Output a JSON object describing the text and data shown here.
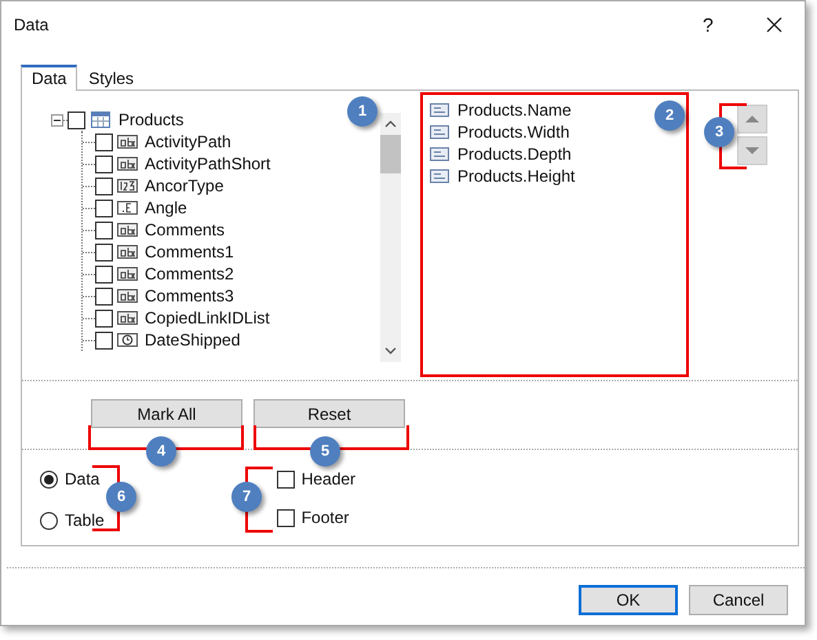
{
  "window": {
    "title": "Data",
    "help": "?"
  },
  "tabs": [
    {
      "label": "Data",
      "selected": true
    },
    {
      "label": "Styles",
      "selected": false
    }
  ],
  "tree": {
    "label": "Products",
    "expanded": true,
    "checked": false,
    "children": [
      {
        "label": "ActivityPath",
        "kind": "text",
        "checked": false
      },
      {
        "label": "ActivityPathShort",
        "kind": "text",
        "checked": false
      },
      {
        "label": "AncorType",
        "kind": "integer",
        "checked": false
      },
      {
        "label": "Angle",
        "kind": "float",
        "checked": false
      },
      {
        "label": "Comments",
        "kind": "text",
        "checked": false
      },
      {
        "label": "Comments1",
        "kind": "text",
        "checked": false
      },
      {
        "label": "Comments2",
        "kind": "text",
        "checked": false
      },
      {
        "label": "Comments3",
        "kind": "text",
        "checked": false
      },
      {
        "label": "CopiedLinkIDList",
        "kind": "text",
        "checked": false
      },
      {
        "label": "DateShipped",
        "kind": "date",
        "checked": false
      }
    ]
  },
  "selected_fields": [
    {
      "label": "Products.Name"
    },
    {
      "label": "Products.Width"
    },
    {
      "label": "Products.Depth"
    },
    {
      "label": "Products.Height"
    }
  ],
  "move_buttons": [
    {
      "kind": "up",
      "disabled": true
    },
    {
      "kind": "down",
      "disabled": true
    }
  ],
  "action_buttons": [
    "Mark All",
    "Reset"
  ],
  "mode_options": [
    {
      "label": "Data",
      "selected": true
    },
    {
      "label": "Table",
      "selected": false
    }
  ],
  "section_options": [
    {
      "label": "Header",
      "checked": false
    },
    {
      "label": "Footer",
      "checked": false
    }
  ],
  "footer_buttons": [
    {
      "label": "OK",
      "default": true
    },
    {
      "label": "Cancel",
      "default": false
    }
  ],
  "callouts": [
    "1",
    "2",
    "3",
    "4",
    "5",
    "6",
    "7"
  ]
}
